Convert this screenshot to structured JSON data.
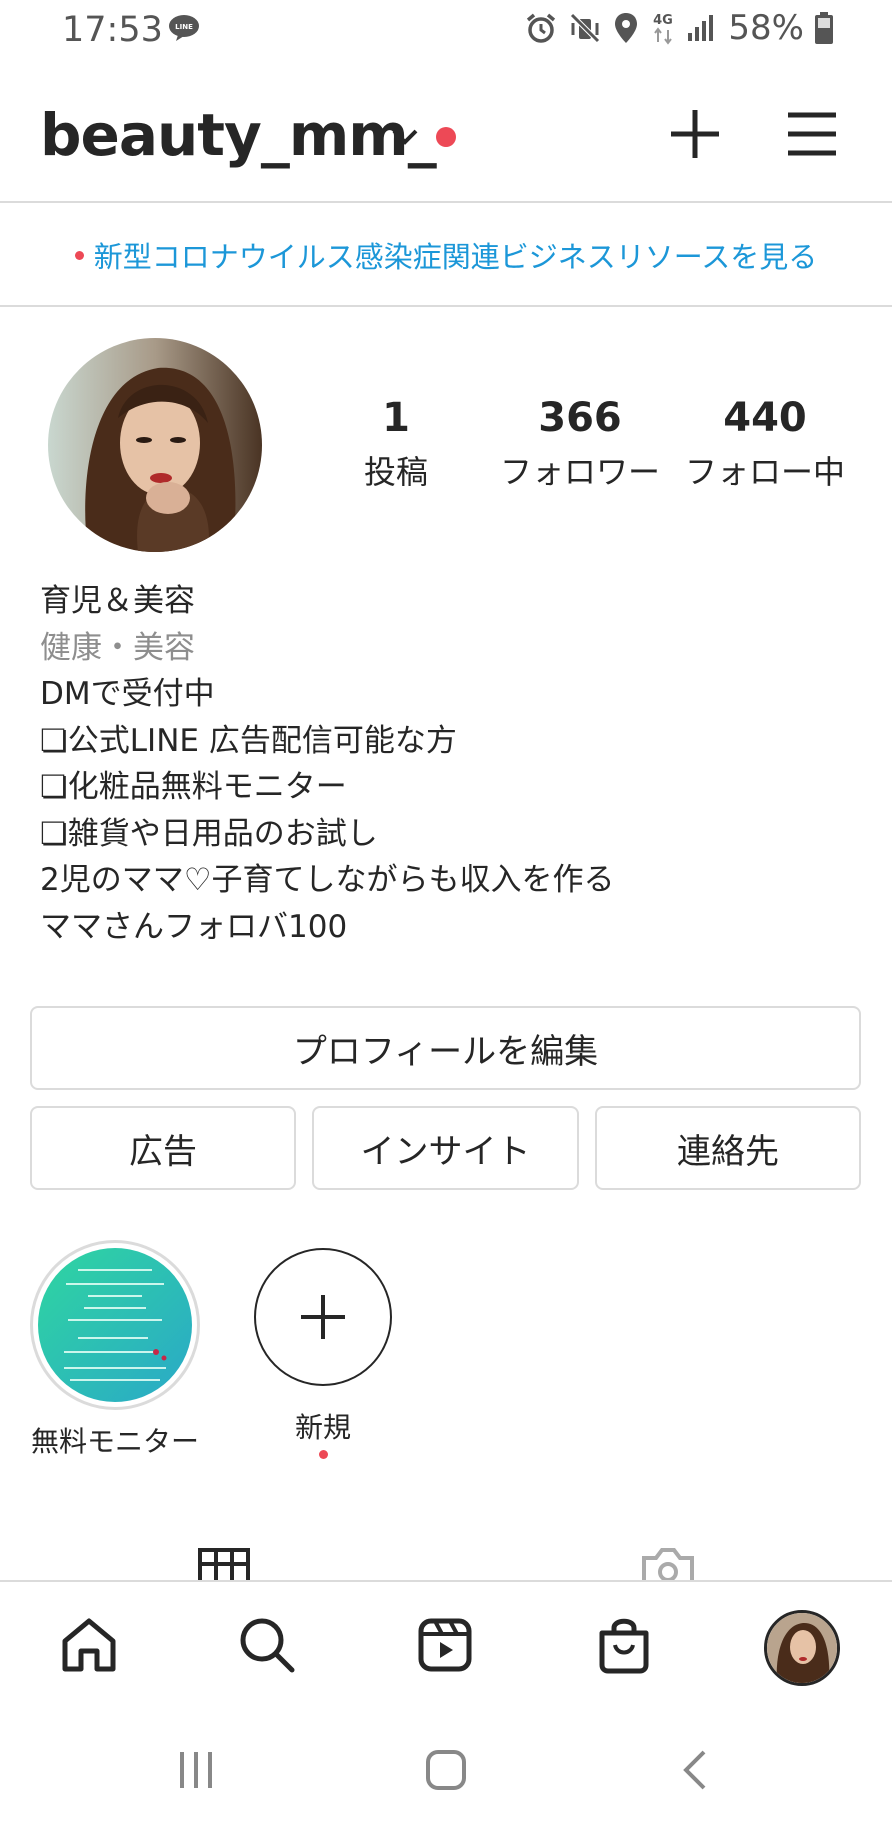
{
  "status_bar": {
    "time": "17:53",
    "battery": "58%",
    "network": "4G",
    "icons": [
      "line-icon",
      "alarm-icon",
      "mute-icon",
      "location-icon",
      "network-4g-icon",
      "signal-icon",
      "battery-icon"
    ]
  },
  "header": {
    "username": "beauty_mm_"
  },
  "banner": {
    "text": "新型コロナウイルス感染症関連ビジネスリソースを見る"
  },
  "profile": {
    "stats": [
      {
        "value": "1",
        "label": "投稿"
      },
      {
        "value": "366",
        "label": "フォロワー"
      },
      {
        "value": "440",
        "label": "フォロー中"
      }
    ],
    "name": "育児＆美容",
    "category": "健康・美容",
    "bio_lines": [
      "DMで受付中",
      "❏公式LINE 広告配信可能な方",
      "❏化粧品無料モニター",
      "❏雑貨や日用品のお試し",
      "2児のママ♡子育てしながらも収入を作る",
      "ママさんフォロバ100"
    ]
  },
  "buttons": {
    "edit_profile": "プロフィールを編集",
    "ads": "広告",
    "insights": "インサイト",
    "contact": "連絡先"
  },
  "highlights": [
    {
      "label": "無料モニター"
    },
    {
      "label": "新規"
    }
  ],
  "colors": {
    "accent_red": "#ed4956",
    "link_blue": "#1c97d8",
    "border": "#dbdbdb",
    "text": "#262626",
    "muted": "#8e8e8e"
  }
}
